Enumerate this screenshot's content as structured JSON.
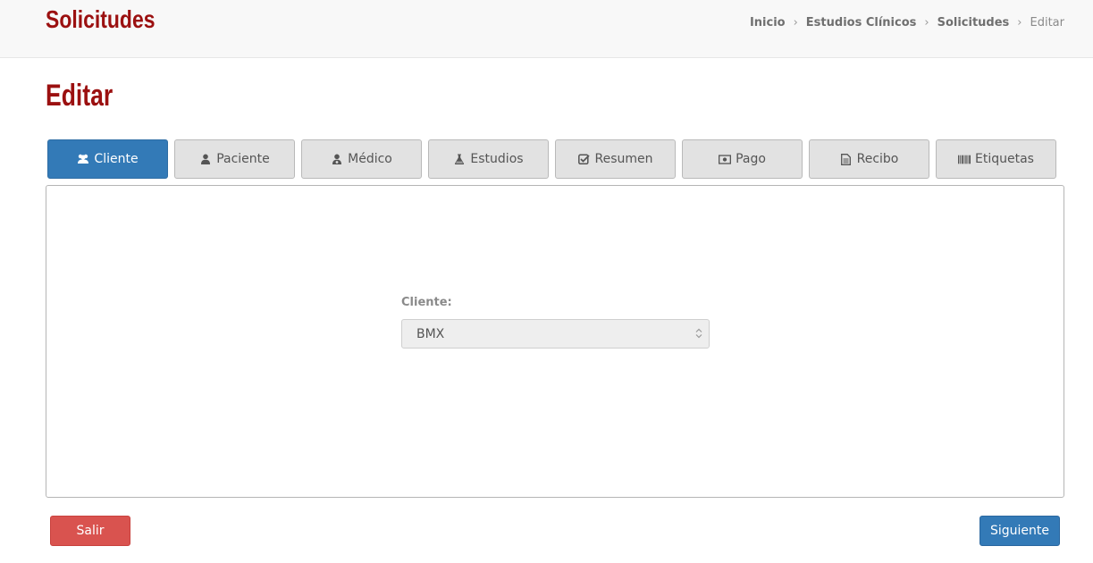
{
  "header": {
    "app_title": "Solicitudes",
    "breadcrumb": [
      {
        "label": "Inicio"
      },
      {
        "label": "Estudios Clínicos"
      },
      {
        "label": "Solicitudes"
      },
      {
        "label": "Editar"
      }
    ],
    "separator": "›"
  },
  "page": {
    "title": "Editar"
  },
  "tabs": [
    {
      "label": "Cliente",
      "icon": "users-icon",
      "active": true
    },
    {
      "label": "Paciente",
      "icon": "user-icon",
      "active": false
    },
    {
      "label": "Médico",
      "icon": "user-md-icon",
      "active": false
    },
    {
      "label": "Estudios",
      "icon": "flask-icon",
      "active": false
    },
    {
      "label": "Resumen",
      "icon": "check-square-icon",
      "active": false
    },
    {
      "label": "Pago",
      "icon": "money-icon",
      "active": false
    },
    {
      "label": "Recibo",
      "icon": "file-text-icon",
      "active": false
    },
    {
      "label": "Etiquetas",
      "icon": "barcode-icon",
      "active": false
    }
  ],
  "form": {
    "client_label": "Cliente:",
    "client_value": "BMX"
  },
  "actions": {
    "exit_label": "Salir",
    "next_label": "Siguiente"
  },
  "colors": {
    "brand_red": "#9b1010",
    "primary_blue": "#337ab7",
    "danger_red": "#d9534f"
  }
}
